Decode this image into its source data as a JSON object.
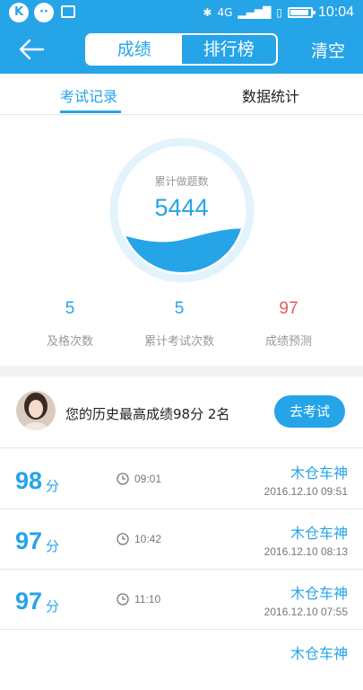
{
  "status_bar": {
    "time": "10:04",
    "network": "4G",
    "icons": [
      "k-app-icon",
      "chat-app-icon",
      "image-icon",
      "bluetooth-icon",
      "signal-icon",
      "sim-icon",
      "battery-icon"
    ]
  },
  "navbar": {
    "tabs": [
      {
        "label": "成绩",
        "active": true
      },
      {
        "label": "排行榜",
        "active": false
      }
    ],
    "right_action": "清空",
    "back_icon": "back-arrow-icon"
  },
  "subtabs": [
    {
      "label": "考试记录",
      "active": true
    },
    {
      "label": "数据统计",
      "active": false
    }
  ],
  "gauge": {
    "label": "累计做题数",
    "value": "5444"
  },
  "stats": [
    {
      "value": "5",
      "label": "及格次数"
    },
    {
      "value": "5",
      "label": "累计考试次数"
    },
    {
      "value": "97",
      "label": "成绩预测"
    }
  ],
  "best": {
    "text": "您的历史最高成绩98分  2名",
    "button": "去考试"
  },
  "records": [
    {
      "score": "98",
      "unit": "分",
      "duration": "09:01",
      "name": "木仓车神",
      "date": "2016.12.10  09:51"
    },
    {
      "score": "97",
      "unit": "分",
      "duration": "10:42",
      "name": "木仓车神",
      "date": "2016.12.10  08:13"
    },
    {
      "score": "97",
      "unit": "分",
      "duration": "11:10",
      "name": "木仓车神",
      "date": "2016.12.10  07:55"
    },
    {
      "score": "",
      "unit": "",
      "duration": "",
      "name": "木仓车神",
      "date": ""
    }
  ],
  "colors": {
    "accent": "#26a4e8",
    "prediction": "#e35b5b"
  }
}
